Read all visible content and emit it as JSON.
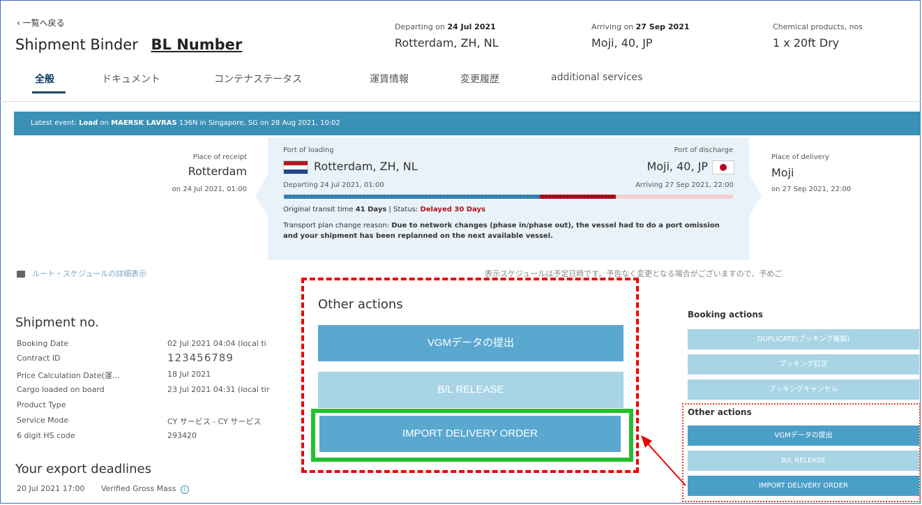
{
  "nav": {
    "back_label": "‹ 一覧へ戻る"
  },
  "header": {
    "title": "Shipment Binder",
    "bl_label": "BL Number",
    "departing_prefix": "Departing on",
    "departing_date": "24 Jul 2021",
    "departing_place": "Rotterdam, ZH, NL",
    "arriving_prefix": "Arriving on",
    "arriving_date": "27 Sep 2021",
    "arriving_place": "Moji, 40, JP",
    "cargo_desc": "Chemical products, nos",
    "container": "1 x 20ft Dry"
  },
  "tabs": [
    {
      "label": "全般",
      "active": true
    },
    {
      "label": "ドキュメント"
    },
    {
      "label": "コンテナステータス"
    },
    {
      "label": "運賃情報"
    },
    {
      "label": "変更履歴"
    },
    {
      "label": "additional services"
    }
  ],
  "banner": {
    "prefix": "Latest event:",
    "event": "Load",
    "on": "on",
    "vessel": "MAERSK LAVRAS",
    "rest": "136N in Singapore, SG on 28 Aug 2021, 10:02"
  },
  "route": {
    "receipt_label": "Place of receipt",
    "receipt_place": "Rotterdam",
    "receipt_time": "on 24 Jul 2021, 01:00",
    "loading_label": "Port of loading",
    "loading_place": "Rotterdam, ZH, NL",
    "discharge_label": "Port of discharge",
    "discharge_place": "Moji, 40, JP",
    "departing_time": "Departing 24 Jul 2021, 01:00",
    "arriving_time": "Arriving 27 Sep 2021, 22:00",
    "delivery_label": "Place of delivery",
    "delivery_place": "Moji",
    "delivery_time": "on 27 Sep 2021, 22:00",
    "transit_prefix": "Original transit time",
    "transit_days": "41 Days",
    "status_prefix": "| Status:",
    "status_value": "Delayed 30 Days",
    "reason_prefix": "Transport plan change reason:",
    "reason_text": "Due to network changes (phase in/phase out), the vessel had to do a port omission and your shipment has been replanned on the next available vessel.",
    "progress_on_time_pct": 57,
    "progress_delayed_pct": 17,
    "colors": {
      "on_time": "#3a83b4",
      "delayed": "#b10f1e",
      "remaining": "#f6cfd3"
    }
  },
  "route_link": "ルート・スケジュールの詳細表示",
  "notice": "表示スケジュールは予定日時です。予告なく変更となる場合がございますので、予めご",
  "shipment": {
    "title": "Shipment no.",
    "rows": [
      {
        "key": "Booking Date",
        "value": "02 Jul 2021 04:04 (local ti"
      },
      {
        "key": "Contract ID",
        "value": "123456789"
      },
      {
        "key": "Price Calculation Date(運...",
        "value": "18 Jul 2021"
      },
      {
        "key": "Cargo loaded on board",
        "value": "23 Jul 2021 04:31 (local tir"
      },
      {
        "key": "Product Type",
        "value": ""
      },
      {
        "key": "Service Mode",
        "value": "CY サービス - CY サービス"
      },
      {
        "key": "6 digit HS code",
        "value": "293420"
      }
    ]
  },
  "deadlines": {
    "title": "Your export deadlines",
    "date": "20 Jul 2021 17:00",
    "label": "Verified Gross Mass"
  },
  "overlay": {
    "title": "Other actions",
    "buttons": [
      "VGMデータの提出",
      "B/L RELEASE",
      "IMPORT DELIVERY ORDER"
    ]
  },
  "booking_actions": {
    "title": "Booking actions",
    "buttons": [
      "DUPLICATE(ブッキング複製)",
      "ブッキング訂正",
      "ブッキングキャンセル"
    ]
  },
  "other_actions_small": {
    "title": "Other actions",
    "buttons": [
      "VGMデータの提出",
      "B/L RELEASE",
      "IMPORT DELIVERY ORDER"
    ]
  }
}
